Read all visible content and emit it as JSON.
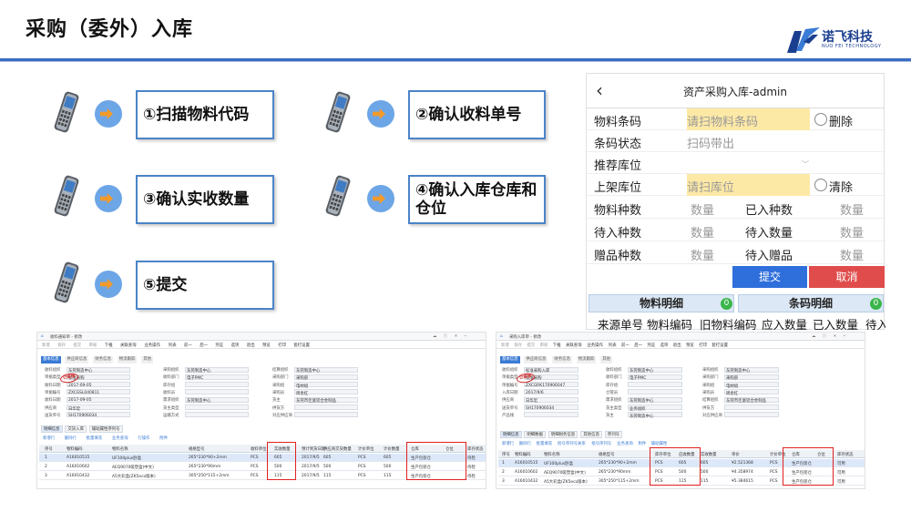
{
  "slide": {
    "title": "采购（委外）入库",
    "logo_text": "诺飞科技",
    "logo_sub": "NUO FEI TECHNOLOGY"
  },
  "steps": [
    {
      "label": "①扫描物料代码"
    },
    {
      "label": "②确认收料单号"
    },
    {
      "label": "③确认实收数量"
    },
    {
      "label": "④确认入库仓库和仓位"
    },
    {
      "label": "⑤提交"
    }
  ],
  "mobile": {
    "back_icon": "chevron-left-icon",
    "title": "资产采购入库-admin",
    "material_code_label": "物料条码",
    "material_code_placeholder": "请扫物料条码",
    "delete_label": "删除",
    "barcode_status_label": "条码状态",
    "barcode_status_value": "扫码带出",
    "recommended_location_label": "推荐库位",
    "shelf_location_label": "上架库位",
    "shelf_location_placeholder": "请扫库位",
    "clear_label": "清除",
    "material_kinds_label": "物料种数",
    "material_kinds_value": "数量",
    "in_kinds_label": "已入种数",
    "in_kinds_value": "数量",
    "pending_in_label": "待入种数",
    "pending_in_value": "数量",
    "pending_qty_label": "待入数量",
    "pending_qty_value": "数量",
    "gift_kinds_label": "赠品种数",
    "gift_kinds_value": "数量",
    "pending_gift_label": "待入赠品",
    "pending_gift_value": "数量",
    "submit_label": "提交",
    "cancel_label": "取消",
    "tab_material_detail": "物料明细",
    "tab_material_count": "0",
    "tab_barcode_detail": "条码明细",
    "tab_barcode_count": "0",
    "columns": [
      "来源单号",
      "物料编码",
      "旧物料编码",
      "应入数量",
      "已入数量",
      "待入"
    ],
    "colors": {
      "yellow": "#fde9a6",
      "submit": "#2f6fdc",
      "cancel": "#e04c4c",
      "badge": "#39b54a"
    }
  },
  "erp_left": {
    "title": "收料通知单 - 修改",
    "toolbar": [
      "新增",
      "保存",
      "提交",
      "审核",
      "下推",
      "关联查询",
      "业务操作",
      "列表",
      "前一",
      "后一",
      "凭证",
      "选项",
      "退出",
      "预览",
      "打印",
      "套打设置"
    ],
    "tabs": [
      "基本信息",
      "供应商信息",
      "财务信息",
      "物流跟踪",
      "其他"
    ],
    "fields_left": [
      [
        "收料组织",
        "东莞制造中心"
      ],
      [
        "单据类型",
        "标准采购"
      ],
      [
        "收料日期",
        "2017-09-05"
      ],
      [
        "单据编号",
        "ZXCGSL040811"
      ],
      [
        "收料日期",
        "2017-09-05"
      ],
      [
        "供应商",
        "日华宏"
      ],
      [
        "送货单号",
        "SH170906034"
      ]
    ],
    "fields_mid": [
      [
        "采购组织",
        "东莞制造中心"
      ],
      [
        "收料部门",
        "电子PMC"
      ],
      [
        "库存组",
        ""
      ],
      [
        "收料员",
        ""
      ],
      [
        "需求组织",
        "东莞制造中心"
      ],
      [
        "货主类型",
        ""
      ],
      [
        "运输方式",
        ""
      ]
    ],
    "fields_right": [
      [
        "结算组织",
        "东莞制造中心"
      ],
      [
        "采购部门",
        "采购部"
      ],
      [
        "采购组",
        "电材组"
      ],
      [
        "采购员",
        "周金红"
      ],
      [
        "货主",
        "东莞市佳富铝合金制品"
      ],
      [
        "供货方",
        ""
      ],
      [
        "对应供应商",
        ""
      ]
    ],
    "detail_tabs": [
      "明细信息",
      "交货入库",
      "辅助属性序列号"
    ],
    "detail_menu": [
      "新增行",
      "删除行",
      "批量填充",
      "业务查询",
      "行操作",
      "附件"
    ],
    "headers": [
      "序号",
      "物料编码",
      "物料名称",
      "规格型号",
      "收料单位",
      "实收数量",
      "预计到货日期",
      "供应商交货数量",
      "计价单位",
      "计价数量",
      "仓库",
      "仓位",
      "库存状态"
    ],
    "rows": [
      [
        "1",
        "A16010515",
        "UF100plus卧盒",
        "265*230*90+2mm",
        "PCS",
        "605",
        "2017/9/5",
        "605",
        "PCS",
        "605",
        "生产包装仓",
        "",
        "待检"
      ],
      [
        "2",
        "A16010602",
        "AEQ9070吸塑盒(中文)",
        "265*230*90mm",
        "PCS",
        "500",
        "2017/9/5",
        "500",
        "PCS",
        "500",
        "生产包装仓",
        "",
        "待检"
      ],
      [
        "3",
        "A16010432",
        "A5大彩盒(ZK5eco版本)",
        "305*250*115+2mm",
        "PCS",
        "115",
        "2017/9/5",
        "115",
        "PCS",
        "115",
        "生产包装仓",
        "",
        "待检"
      ]
    ],
    "stamp": "已审核"
  },
  "erp_right": {
    "title": "采购入库单 - 修改",
    "toolbar": [
      "新增",
      "保存",
      "提交",
      "审核",
      "下推",
      "关联查询",
      "业务操作",
      "列表",
      "前一",
      "后一",
      "凭证",
      "选项",
      "退出",
      "预览",
      "打印",
      "套打设置"
    ],
    "tabs": [
      "基本信息",
      "供应商信息",
      "财务信息",
      "物流跟踪",
      "其他"
    ],
    "fields_left": [
      [
        "收料组织",
        "标准采购入库"
      ],
      [
        "单据类型",
        "标准采购"
      ],
      [
        "单据编号",
        "ZXCGRK170906047"
      ],
      [
        "入库日期",
        "2017/9/6"
      ],
      [
        "供应商",
        "日华宏"
      ],
      [
        "送货单号",
        "SH170906034"
      ],
      [
        "产品线",
        ""
      ]
    ],
    "fields_mid": [
      [
        "收料组织",
        "东莞制造中心"
      ],
      [
        "收料部门",
        "电子PMC"
      ],
      [
        "库存组",
        ""
      ],
      [
        "仓管员",
        ""
      ],
      [
        "需求组织",
        "东莞制造中心"
      ],
      [
        "货主类型",
        "业务组织"
      ],
      [
        "货主",
        "东莞制造中心"
      ]
    ],
    "fields_right": [
      [
        "采购组织",
        "东莞制造中心"
      ],
      [
        "采购部门",
        "采购部"
      ],
      [
        "采购组",
        "电材组"
      ],
      [
        "采购员",
        "周金红"
      ],
      [
        "结算组织",
        "东莞市佳富铝合金制品"
      ],
      [
        "供货方",
        ""
      ],
      [
        "对应供应商",
        ""
      ]
    ],
    "detail_tabs": [
      "明细信息",
      "明细数据",
      "明细财务信息",
      "其他信息",
      "序列号"
    ],
    "detail_menu": [
      "新增行",
      "删除行",
      "批量填充",
      "批号序列号关系",
      "批号序列号",
      "业务查询",
      "附件",
      "辅助属性"
    ],
    "headers": [
      "序号",
      "物料编码",
      "物料名称",
      "规格型号",
      "库存单位",
      "应收数量",
      "实收数量",
      "单价",
      "计价单位",
      "仓库",
      "仓位",
      "库存状态"
    ],
    "rows": [
      [
        "1",
        "A16010515",
        "UF100plus卧盒",
        "265*230*90+2mm",
        "PCS",
        "605",
        "605",
        "¥2.521368",
        "PCS",
        "生产包装仓",
        "",
        "可用"
      ],
      [
        "2",
        "A16010602",
        "AEQ9070吸塑盒(中文)",
        "265*230*90mm",
        "PCS",
        "500",
        "500",
        "¥4.358974",
        "PCS",
        "生产包装仓",
        "",
        "可用"
      ],
      [
        "3",
        "A16010432",
        "A5大彩盒(ZK5eco版本)",
        "305*250*115+2mm",
        "PCS",
        "115",
        "115",
        "¥5.384615",
        "PCS",
        "生产包装仓",
        "",
        "可用"
      ]
    ],
    "stamp": "已审核"
  }
}
